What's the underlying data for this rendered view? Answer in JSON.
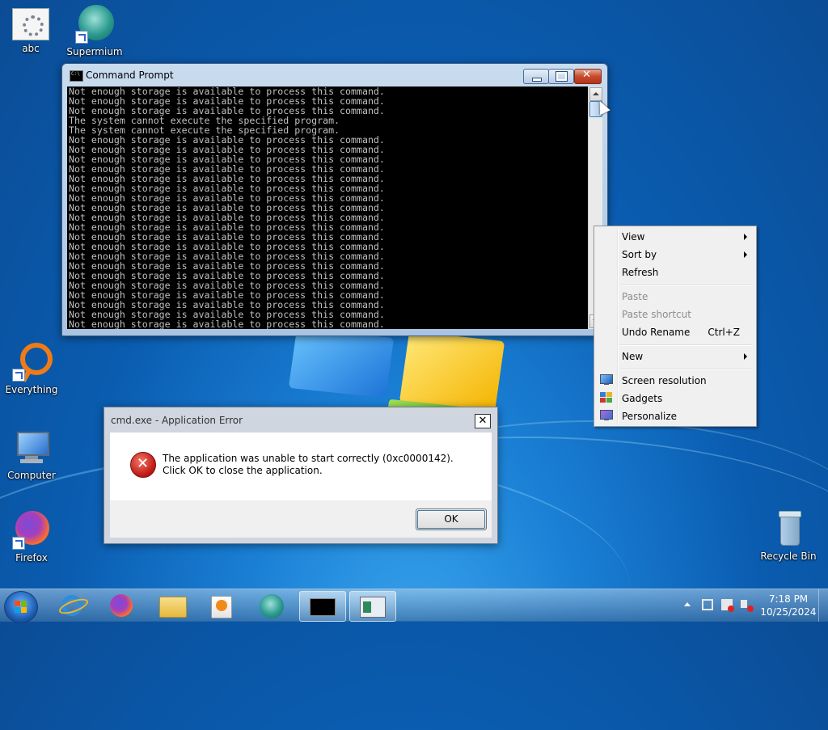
{
  "desktop": {
    "icons": [
      {
        "label": "abc"
      },
      {
        "label": "Supermium"
      },
      {
        "label": "Everything"
      },
      {
        "label": "Computer"
      },
      {
        "label": "Firefox"
      },
      {
        "label": "Recycle Bin"
      }
    ]
  },
  "cmd_window": {
    "title": "Command Prompt",
    "lines": [
      "Not enough storage is available to process this command.",
      "Not enough storage is available to process this command.",
      "Not enough storage is available to process this command.",
      "The system cannot execute the specified program.",
      "The system cannot execute the specified program.",
      "Not enough storage is available to process this command.",
      "Not enough storage is available to process this command.",
      "Not enough storage is available to process this command.",
      "Not enough storage is available to process this command.",
      "Not enough storage is available to process this command.",
      "Not enough storage is available to process this command.",
      "Not enough storage is available to process this command.",
      "Not enough storage is available to process this command.",
      "Not enough storage is available to process this command.",
      "Not enough storage is available to process this command.",
      "Not enough storage is available to process this command.",
      "Not enough storage is available to process this command.",
      "Not enough storage is available to process this command.",
      "Not enough storage is available to process this command.",
      "Not enough storage is available to process this command.",
      "Not enough storage is available to process this command.",
      "Not enough storage is available to process this command.",
      "Not enough storage is available to process this command.",
      "Not enough storage is available to process this command.",
      "Not enough storage is available to process this command."
    ]
  },
  "error_dialog": {
    "title": "cmd.exe - Application Error",
    "close_glyph": "✕",
    "message": "The application was unable to start correctly (0xc0000142). Click OK to close the application.",
    "ok_label": "OK"
  },
  "context_menu": {
    "items": [
      {
        "label": "View",
        "submenu": true
      },
      {
        "label": "Sort by",
        "submenu": true
      },
      {
        "label": "Refresh"
      },
      {
        "label": "Paste",
        "disabled": true
      },
      {
        "label": "Paste shortcut",
        "disabled": true
      },
      {
        "label": "Undo Rename",
        "shortcut": "Ctrl+Z"
      },
      {
        "label": "New",
        "submenu": true
      },
      {
        "label": "Screen resolution",
        "icon": "screen-resolution-icon"
      },
      {
        "label": "Gadgets",
        "icon": "gadgets-icon"
      },
      {
        "label": "Personalize",
        "icon": "personalize-icon"
      }
    ]
  },
  "taskbar": {
    "pinned": [
      "start-button",
      "internet-explorer-icon",
      "firefox-icon",
      "file-explorer-icon",
      "media-player-icon",
      "supermium-icon",
      "command-prompt-icon",
      "application-window-icon"
    ],
    "clock_time": "7:18 PM",
    "clock_date": "10/25/2024"
  }
}
